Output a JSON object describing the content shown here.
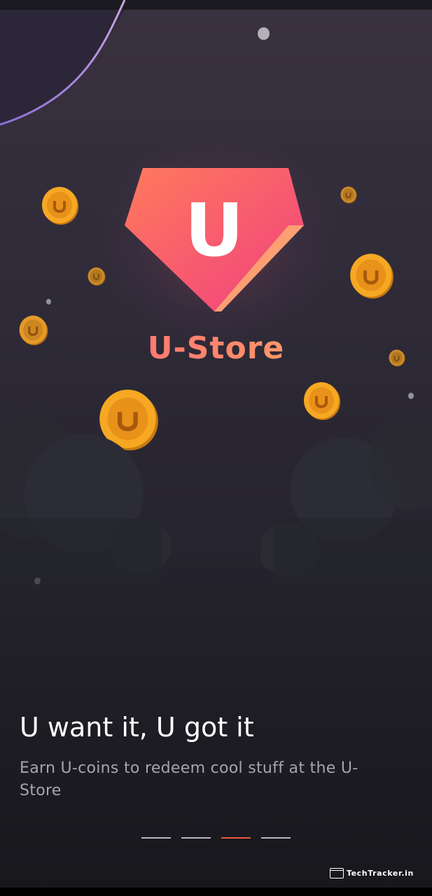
{
  "hero": {
    "logo_letter": "U",
    "brand_name": "U-Store",
    "coin_icon": "u-coin-icon"
  },
  "onboarding": {
    "headline": "U want it, U got it",
    "description": "Earn U-coins to redeem cool stuff at the U-Store",
    "page_count": 4,
    "active_page": 3
  },
  "watermark": {
    "text": "TechTracker.in"
  },
  "colors": {
    "accent": "#e8583f",
    "brand_gradient_start": "#ff5f7e",
    "brand_gradient_end": "#ffc36b",
    "coin": "#f5a623"
  }
}
